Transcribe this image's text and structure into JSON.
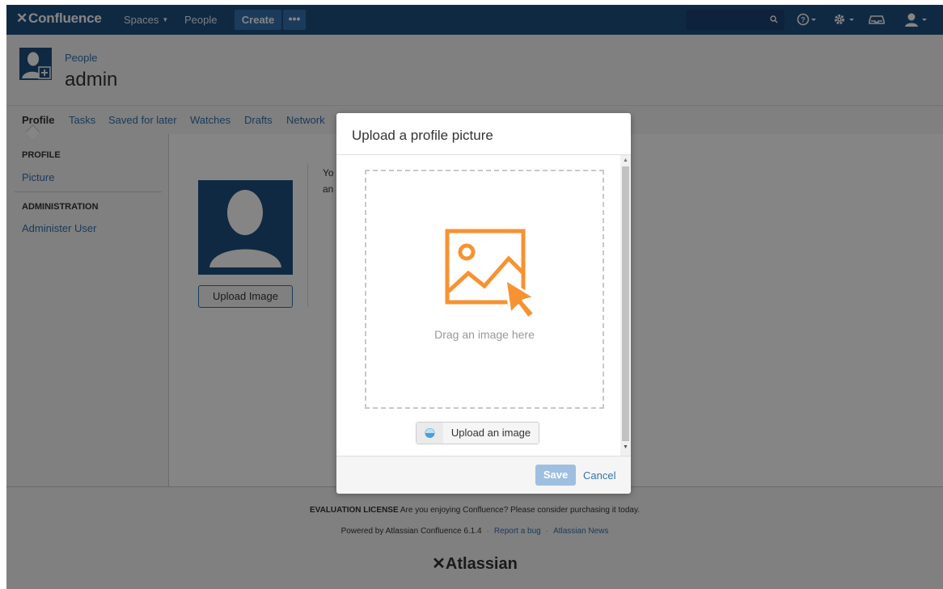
{
  "nav": {
    "logo": "Confluence",
    "spaces": "Spaces",
    "people": "People",
    "create": "Create",
    "more": "•••"
  },
  "header": {
    "breadcrumb": "People",
    "title": "admin"
  },
  "tabs": [
    "Profile",
    "Tasks",
    "Saved for later",
    "Watches",
    "Drafts",
    "Network"
  ],
  "sidebar": {
    "profile_heading": "PROFILE",
    "picture_link": "Picture",
    "admin_heading": "ADMINISTRATION",
    "administer_link": "Administer User"
  },
  "main": {
    "upload_image_button": "Upload Image",
    "partial_text_1": "Yo",
    "partial_text_2": "an"
  },
  "dialog": {
    "title": "Upload a profile picture",
    "drop_text": "Drag an image here",
    "upload_button": "Upload an image",
    "save": "Save",
    "cancel": "Cancel"
  },
  "footer": {
    "license_bold": "EVALUATION LICENSE",
    "license_text": "Are you enjoying Confluence? Please consider purchasing it today.",
    "powered": "Powered by Atlassian Confluence 6.1.4",
    "report_bug": "Report a bug",
    "news": "Atlassian News",
    "atlassian_logo": "Atlassian"
  },
  "colors": {
    "nav_bg": "#205081",
    "link": "#3572b0",
    "accent_orange": "#f79232",
    "save_disabled": "#9fbfe0"
  }
}
